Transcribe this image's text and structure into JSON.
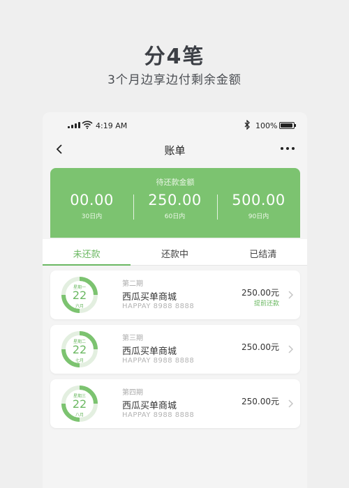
{
  "promo": {
    "title": "分4笔",
    "subtitle": "3个月边享边付剩余金额"
  },
  "status_bar": {
    "time": "4:19 AM",
    "battery": "100%"
  },
  "nav": {
    "title": "账单",
    "back_icon": "chevron-left-icon",
    "more_icon": "more-dots-icon"
  },
  "summary": {
    "label": "待还款金额",
    "amounts": [
      {
        "value": "00.00",
        "desc": "30日内"
      },
      {
        "value": "250.00",
        "desc": "60日内"
      },
      {
        "value": "500.00",
        "desc": "90日内"
      }
    ],
    "color": "#7cc370"
  },
  "tabs": [
    {
      "label": "未还款",
      "active": true
    },
    {
      "label": "还款中",
      "active": false
    },
    {
      "label": "已结清",
      "active": false
    }
  ],
  "bills": [
    {
      "weekday": "星期一",
      "day": "22",
      "month": "六月",
      "period": "第二期",
      "merchant": "西瓜买单商城",
      "code": "HAPPAY 8988 8888",
      "amount": "250.00元",
      "tag": "提前还款"
    },
    {
      "weekday": "星期二",
      "day": "22",
      "month": "七月",
      "period": "第三期",
      "merchant": "西瓜买单商城",
      "code": "HAPPAY 8988 8888",
      "amount": "250.00元",
      "tag": ""
    },
    {
      "weekday": "星期三",
      "day": "22",
      "month": "八月",
      "period": "第四期",
      "merchant": "西瓜买单商城",
      "code": "HAPPAY 8988 8888",
      "amount": "250.00元",
      "tag": ""
    }
  ],
  "accent_color": "#6bb862"
}
